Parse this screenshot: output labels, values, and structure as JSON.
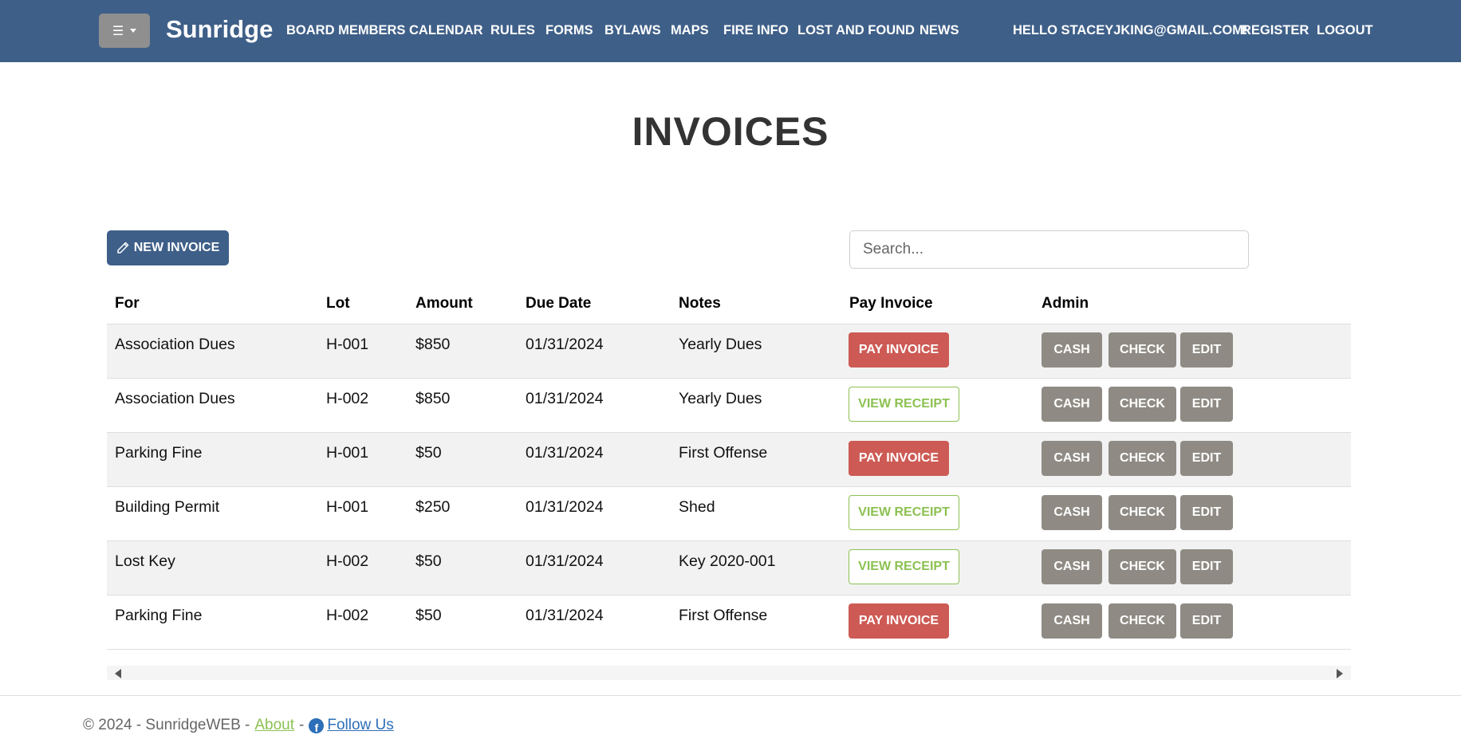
{
  "nav": {
    "menu_icon": "hamburger-icon",
    "brand": "Sunridge",
    "links": [
      "BOARD MEMBERS",
      "CALENDAR",
      "RULES",
      "FORMS",
      "BYLAWS",
      "MAPS",
      "FIRE INFO",
      "LOST AND FOUND",
      "NEWS"
    ],
    "greeting": "HELLO STACEYJKING@GMAIL.COM!",
    "register": "REGISTER",
    "logout": "LOGOUT",
    "background_color": "#3e5f88"
  },
  "page": {
    "title": "INVOICES",
    "new_invoice_label": "NEW INVOICE",
    "new_invoice_icon": "pencil-icon",
    "search_placeholder": "Search..."
  },
  "table": {
    "headers": [
      "For",
      "Lot",
      "Amount",
      "Due Date",
      "Notes",
      "Pay Invoice",
      "Admin"
    ],
    "rows": [
      {
        "for": "Association Dues",
        "lot": "H-001",
        "amount": "$850",
        "due": "01/31/2024",
        "notes": "Yearly Dues",
        "action": "PAY INVOICE"
      },
      {
        "for": "Association Dues",
        "lot": "H-002",
        "amount": "$850",
        "due": "01/31/2024",
        "notes": "Yearly Dues",
        "action": "VIEW RECEIPT"
      },
      {
        "for": "Parking Fine",
        "lot": "H-001",
        "amount": "$50",
        "due": "01/31/2024",
        "notes": "First Offense",
        "action": "PAY INVOICE"
      },
      {
        "for": "Building Permit",
        "lot": "H-001",
        "amount": "$250",
        "due": "01/31/2024",
        "notes": "Shed",
        "action": "VIEW RECEIPT"
      },
      {
        "for": "Lost Key",
        "lot": "H-002",
        "amount": "$50",
        "due": "01/31/2024",
        "notes": "Key 2020-001",
        "action": "VIEW RECEIPT"
      },
      {
        "for": "Parking Fine",
        "lot": "H-002",
        "amount": "$50",
        "due": "01/31/2024",
        "notes": "First Offense",
        "action": "PAY INVOICE"
      }
    ],
    "admin_buttons": [
      "CASH",
      "CHECK",
      "EDIT"
    ],
    "colors": {
      "pay": "#cd5a54",
      "receipt": "#8cc152",
      "admin": "#8f8b84"
    }
  },
  "footer": {
    "copyright": "© 2024 - SunridgeWEB -",
    "separator": "-",
    "about": "About",
    "follow": "Follow Us",
    "follow_icon": "facebook-icon"
  }
}
